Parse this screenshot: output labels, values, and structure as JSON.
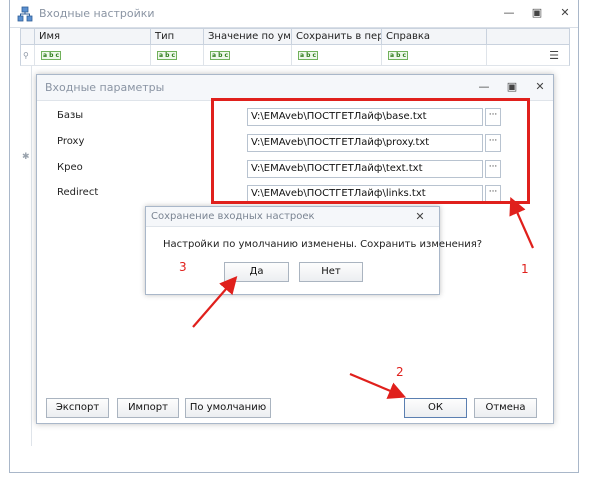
{
  "bg_window": {
    "title": "Входные настройки",
    "columns": [
      "Имя",
      "Тип",
      "Значение по умо...",
      "Сохранить в пер...",
      "Справка"
    ],
    "row_cell_icon": "abc-text-icon",
    "gutter_marks": [
      "•",
      "✱"
    ]
  },
  "params_dialog": {
    "title": "Входные параметры",
    "params": [
      {
        "label": "Базы",
        "value": "V:\\EMAveb\\ПОСТГЕТЛайф\\base.txt"
      },
      {
        "label": "Proxy",
        "value": "V:\\EMAveb\\ПОСТГЕТЛайф\\proxy.txt"
      },
      {
        "label": "Крео",
        "value": "V:\\EMAveb\\ПОСТГЕТЛайф\\text.txt"
      },
      {
        "label": "Redirect",
        "value": "V:\\EMAveb\\ПОСТГЕТЛайф\\links.txt"
      }
    ],
    "browse_label": "···",
    "buttons": {
      "export": "Экспорт",
      "import": "Импорт",
      "defaults": "По умолчанию",
      "ok": "ОК",
      "cancel": "Отмена"
    }
  },
  "confirm_dialog": {
    "title": "Сохранение входных настроек",
    "message": "Настройки по умолчанию изменены. Сохранить изменения?",
    "yes": "Да",
    "no": "Нет"
  },
  "annotations": {
    "color": "#e0201c",
    "labels": [
      "1",
      "2",
      "3"
    ]
  },
  "window_buttons": {
    "minimize": "—",
    "restore": "▣",
    "close": "✕"
  }
}
